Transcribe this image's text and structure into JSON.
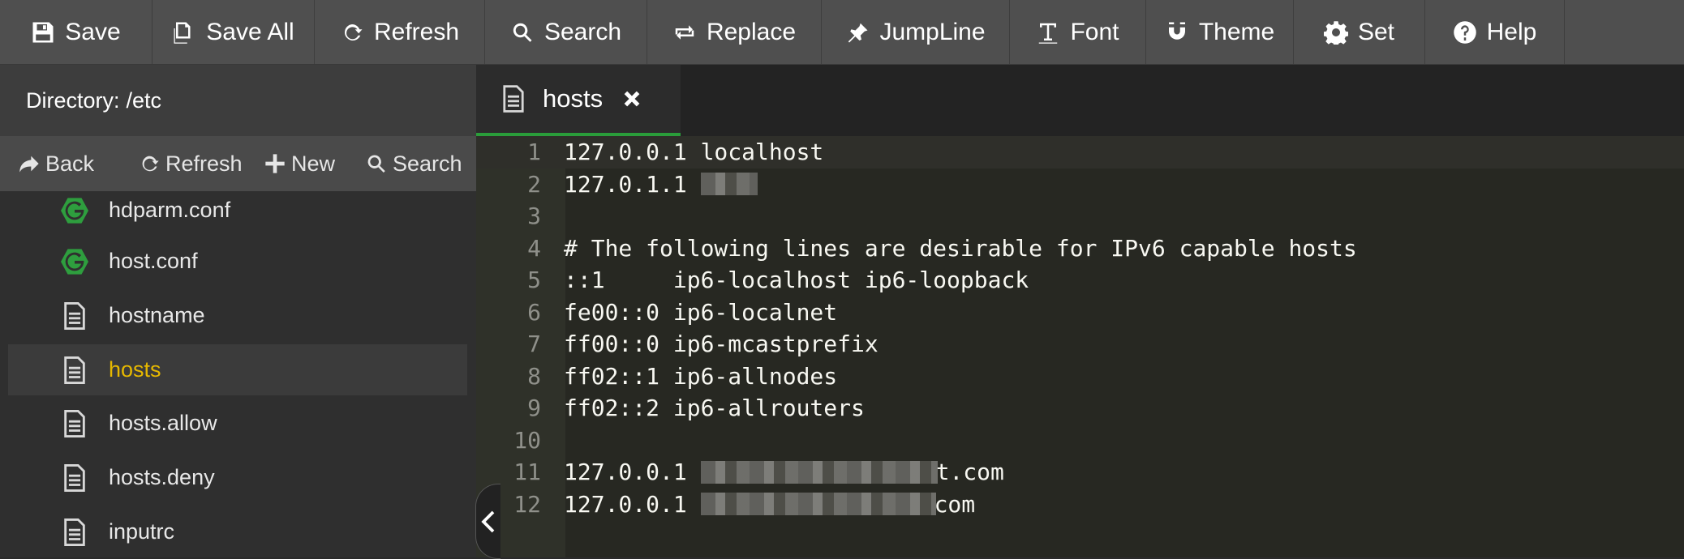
{
  "toolbar": {
    "items": [
      {
        "label": "Save",
        "icon": "save-icon"
      },
      {
        "label": "Save All",
        "icon": "save-all-icon"
      },
      {
        "label": "Refresh",
        "icon": "refresh-icon"
      },
      {
        "label": "Search",
        "icon": "search-icon"
      },
      {
        "label": "Replace",
        "icon": "replace-icon"
      },
      {
        "label": "JumpLine",
        "icon": "pin-icon"
      },
      {
        "label": "Font",
        "icon": "font-icon"
      },
      {
        "label": "Theme",
        "icon": "magnet-icon"
      },
      {
        "label": "Set",
        "icon": "gear-icon"
      },
      {
        "label": "Help",
        "icon": "help-icon"
      }
    ]
  },
  "sidebar": {
    "directory_label": "Directory:",
    "directory_path": "/etc",
    "actions": [
      {
        "label": "Back",
        "icon": "back-arrow-icon"
      },
      {
        "label": "Refresh",
        "icon": "refresh-icon"
      },
      {
        "label": "New",
        "icon": "plus-icon"
      },
      {
        "label": "Search",
        "icon": "search-icon"
      }
    ],
    "files": [
      {
        "name": "hdparm.conf",
        "icon": "config-file-icon"
      },
      {
        "name": "host.conf",
        "icon": "config-file-icon"
      },
      {
        "name": "hostname",
        "icon": "text-file-icon"
      },
      {
        "name": "hosts",
        "icon": "text-file-icon",
        "active": true
      },
      {
        "name": "hosts.allow",
        "icon": "text-file-icon"
      },
      {
        "name": "hosts.deny",
        "icon": "text-file-icon"
      },
      {
        "name": "inputrc",
        "icon": "text-file-icon"
      }
    ]
  },
  "editor": {
    "tab": {
      "label": "hosts"
    },
    "lines": [
      {
        "n": "1",
        "text": "127.0.0.1 localhost"
      },
      {
        "n": "2",
        "text": "127.0.1.1 "
      },
      {
        "n": "3",
        "text": ""
      },
      {
        "n": "4",
        "text": "# The following lines are desirable for IPv6 capable hosts"
      },
      {
        "n": "5",
        "text": "::1     ip6-localhost ip6-loopback"
      },
      {
        "n": "6",
        "text": "fe00::0 ip6-localnet"
      },
      {
        "n": "7",
        "text": "ff00::0 ip6-mcastprefix"
      },
      {
        "n": "8",
        "text": "ff02::1 ip6-allnodes"
      },
      {
        "n": "9",
        "text": "ff02::2 ip6-allrouters"
      },
      {
        "n": "10",
        "text": ""
      },
      {
        "n": "11",
        "text": "127.0.0.1 ",
        "tail": "t.com"
      },
      {
        "n": "12",
        "text": "127.0.0.1 ",
        "tail": "com"
      }
    ]
  },
  "colors": {
    "active_file": "#e6b800",
    "tab_underline": "#2a9d3a",
    "config_icon": "#2e9e3e"
  }
}
